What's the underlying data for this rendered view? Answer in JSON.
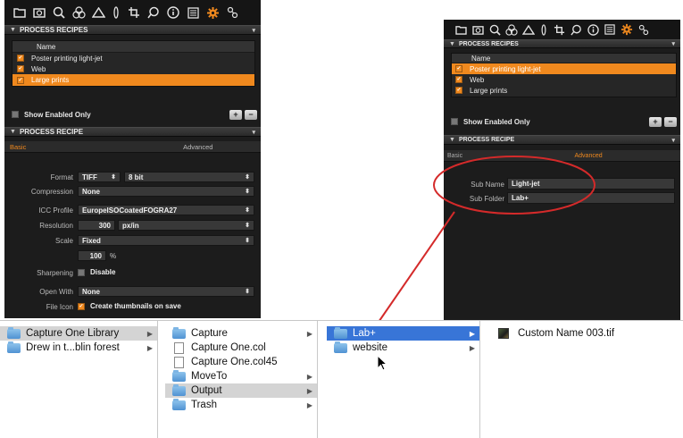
{
  "colors": {
    "accent": "#f0891e",
    "panel_bg": "#1c1c1c",
    "annotation": "#d42a2a",
    "finder_selection": "#3875d7"
  },
  "toolbar_icons": [
    "library-icon",
    "camera-icon",
    "magnifier-icon",
    "color-circles-icon",
    "exposure-icon",
    "lens-icon",
    "crop-icon",
    "focus-icon",
    "info-icon",
    "list-icon",
    "gear-icon",
    "output-icon"
  ],
  "left_panel": {
    "recipes_header": "PROCESS RECIPES",
    "list_header": "Name",
    "recipes": [
      {
        "label": "Poster printing light-jet",
        "checked": true,
        "selected": false
      },
      {
        "label": "Web",
        "checked": true,
        "selected": false
      },
      {
        "label": "Large prints",
        "checked": true,
        "selected": true
      }
    ],
    "show_enabled": "Show Enabled Only",
    "plus": "+",
    "minus": "−",
    "recipe_header": "PROCESS RECIPE",
    "tab_basic": "Basic",
    "tab_advanced": "Advanced",
    "format_label": "Format",
    "format_value": "TIFF",
    "bit_value": "8 bit",
    "compression_label": "Compression",
    "compression_value": "None",
    "icc_label": "ICC Profile",
    "icc_value": "EuropeISOCoatedFOGRA27",
    "resolution_label": "Resolution",
    "resolution_value": "300",
    "resolution_unit": "px/in",
    "scale_label": "Scale",
    "scale_value": "Fixed",
    "scale_percent": "100",
    "percent_sign": "%",
    "sharpening_label": "Sharpening",
    "sharpening_value": "Disable",
    "open_with_label": "Open With",
    "open_with_value": "None",
    "file_icon_label": "File Icon",
    "file_icon_value": "Create thumbnails on save"
  },
  "right_panel": {
    "recipes_header": "PROCESS RECIPES",
    "list_header": "Name",
    "recipes": [
      {
        "label": "Poster printing light-jet",
        "checked": true,
        "selected": true
      },
      {
        "label": "Web",
        "checked": true,
        "selected": false
      },
      {
        "label": "Large prints",
        "checked": true,
        "selected": false
      }
    ],
    "show_enabled": "Show Enabled Only",
    "plus": "+",
    "minus": "−",
    "recipe_header": "PROCESS RECIPE",
    "tab_basic": "Basic",
    "tab_advanced": "Advanced",
    "sub_name_label": "Sub Name",
    "sub_name_value": "Light-jet",
    "sub_folder_label": "Sub Folder",
    "sub_folder_value": "Lab+"
  },
  "finder": {
    "col1": [
      {
        "label": "Capture One Library",
        "selected": true
      },
      {
        "label": "Drew in t...blin forest",
        "selected": false
      }
    ],
    "col2": [
      {
        "label": "Capture",
        "type": "folder",
        "arrow": true
      },
      {
        "label": "Capture One.col",
        "type": "file",
        "arrow": false
      },
      {
        "label": "Capture One.col45",
        "type": "file",
        "arrow": false
      },
      {
        "label": "MoveTo",
        "type": "folder",
        "arrow": true
      },
      {
        "label": "Output",
        "type": "folder",
        "arrow": true,
        "selected": true
      },
      {
        "label": "Trash",
        "type": "folder",
        "arrow": true
      }
    ],
    "col3": [
      {
        "label": "Lab+",
        "selected": true
      },
      {
        "label": "website",
        "selected": false
      }
    ],
    "col4": [
      {
        "label": "Custom Name 003.tif"
      }
    ]
  }
}
